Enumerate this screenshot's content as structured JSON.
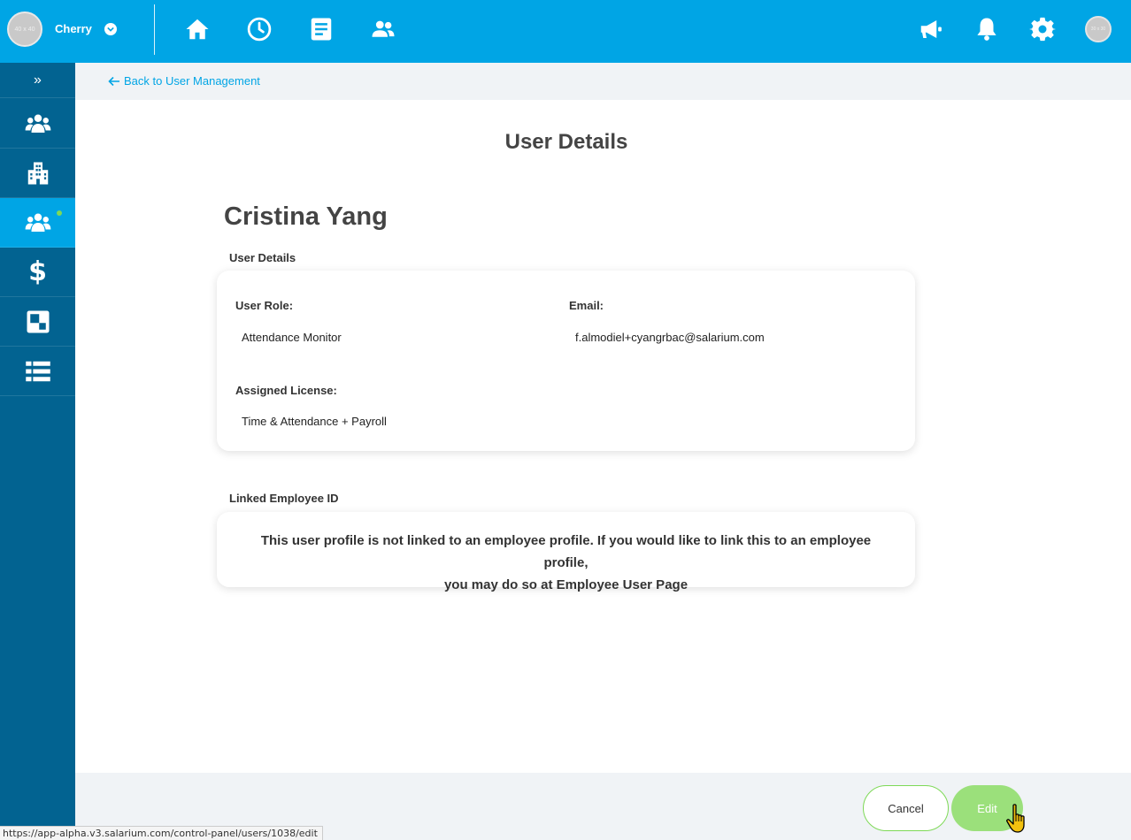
{
  "topbar": {
    "avatar_text": "40 x 40",
    "company_name": "Cherry",
    "user_avatar_text": "30 x 30",
    "nav_icons": [
      "home-icon",
      "clock-icon",
      "document-icon",
      "people-icon"
    ],
    "right_icons": [
      "megaphone-icon",
      "bell-icon",
      "gear-icon"
    ]
  },
  "sidebar": {
    "toggle": "»",
    "items": [
      "users-group-icon",
      "building-icon",
      "users-group-icon",
      "dollar-icon",
      "squares-icon",
      "list-icon"
    ],
    "active_index": 2,
    "dollar_glyph": "$"
  },
  "breadcrumb": {
    "back_label": "Back to User Management"
  },
  "page": {
    "title": "User Details",
    "user_name": "Cristina Yang"
  },
  "user_details": {
    "section_label": "User Details",
    "role_label": "User Role:",
    "role_value": "Attendance Monitor",
    "email_label": "Email:",
    "email_value": "f.almodiel+cyangrbac@salarium.com",
    "license_label": "Assigned License:",
    "license_value": "Time & Attendance + Payroll"
  },
  "linked": {
    "section_label": "Linked Employee ID",
    "notice_line1": "This user profile is not linked to an employee profile. If you would like to link this to an employee profile,",
    "notice_line2": "you may do so at Employee User Page"
  },
  "footer": {
    "cancel_label": "Cancel",
    "edit_label": "Edit"
  },
  "status_bar": {
    "url": "https://app-alpha.v3.salarium.com/control-panel/users/1038/edit"
  },
  "colors": {
    "brand_blue": "#00a5e5",
    "sidebar_blue": "#026391",
    "accent_green": "#7ed957",
    "edit_green": "#9be07b"
  }
}
